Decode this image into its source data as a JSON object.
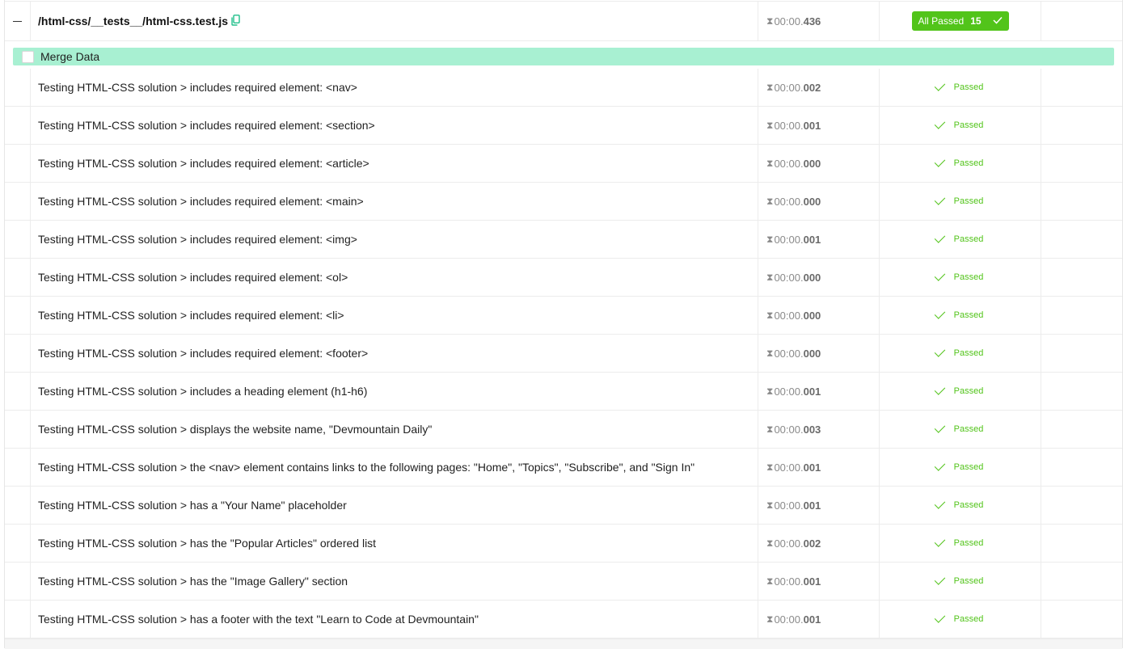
{
  "suite": {
    "path": "/html-css/__tests__/html-css.test.js",
    "time_prefix": "00:00.",
    "time_ms": "436",
    "status_label": "All Passed",
    "count": "15"
  },
  "merge": {
    "label": "Merge Data"
  },
  "status_text": "Passed",
  "tests": [
    {
      "title": "Testing HTML-CSS solution > includes required element: <nav>",
      "time_prefix": "00:00.",
      "time_ms": "002"
    },
    {
      "title": "Testing HTML-CSS solution > includes required element: <section>",
      "time_prefix": "00:00.",
      "time_ms": "001"
    },
    {
      "title": "Testing HTML-CSS solution > includes required element: <article>",
      "time_prefix": "00:00.",
      "time_ms": "000"
    },
    {
      "title": "Testing HTML-CSS solution > includes required element: <main>",
      "time_prefix": "00:00.",
      "time_ms": "000"
    },
    {
      "title": "Testing HTML-CSS solution > includes required element: <img>",
      "time_prefix": "00:00.",
      "time_ms": "001"
    },
    {
      "title": "Testing HTML-CSS solution > includes required element: <ol>",
      "time_prefix": "00:00.",
      "time_ms": "000"
    },
    {
      "title": "Testing HTML-CSS solution > includes required element: <li>",
      "time_prefix": "00:00.",
      "time_ms": "000"
    },
    {
      "title": "Testing HTML-CSS solution > includes required element: <footer>",
      "time_prefix": "00:00.",
      "time_ms": "000"
    },
    {
      "title": "Testing HTML-CSS solution > includes a heading element (h1-h6)",
      "time_prefix": "00:00.",
      "time_ms": "001"
    },
    {
      "title": "Testing HTML-CSS solution > displays the website name, \"Devmountain Daily\"",
      "time_prefix": "00:00.",
      "time_ms": "003"
    },
    {
      "title": "Testing HTML-CSS solution > the <nav> element contains links to the following pages: \"Home\", \"Topics\", \"Subscribe\", and \"Sign In\"",
      "time_prefix": "00:00.",
      "time_ms": "001"
    },
    {
      "title": "Testing HTML-CSS solution > has a \"Your Name\" placeholder",
      "time_prefix": "00:00.",
      "time_ms": "001"
    },
    {
      "title": "Testing HTML-CSS solution > has the \"Popular Articles\" ordered list",
      "time_prefix": "00:00.",
      "time_ms": "002"
    },
    {
      "title": "Testing HTML-CSS solution > has the \"Image Gallery\" section",
      "time_prefix": "00:00.",
      "time_ms": "001"
    },
    {
      "title": "Testing HTML-CSS solution > has a footer with the text \"Learn to Code at Devmountain\"",
      "time_prefix": "00:00.",
      "time_ms": "001"
    }
  ],
  "colors": {
    "pass": "#52c41a",
    "merge_bar": "#a8f0d2",
    "copy_icon": "#1fbf8a"
  }
}
